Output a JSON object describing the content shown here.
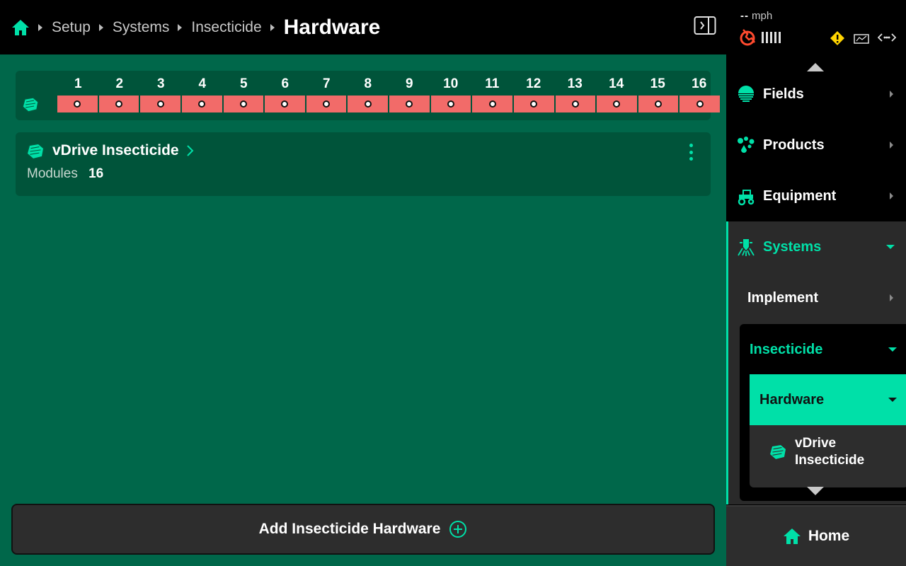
{
  "breadcrumb": {
    "items": [
      "Setup",
      "Systems",
      "Insecticide"
    ],
    "current": "Hardware"
  },
  "module_strip": {
    "rows": [
      "1",
      "2",
      "3",
      "4",
      "5",
      "6",
      "7",
      "8",
      "9",
      "10",
      "11",
      "12",
      "13",
      "14",
      "15",
      "16"
    ]
  },
  "hardware_card": {
    "title": "vDrive Insecticide",
    "modules_label": "Modules",
    "modules_value": "16"
  },
  "add_button": {
    "label": "Add Insecticide Hardware"
  },
  "status": {
    "speed_value": "--",
    "speed_unit": "mph"
  },
  "sidebar": {
    "fields": "Fields",
    "products": "Products",
    "equipment": "Equipment",
    "systems": "Systems",
    "implement": "Implement",
    "insecticide": "Insecticide",
    "hardware": "Hardware",
    "vdrive_line1": "vDrive",
    "vdrive_line2": "Insecticide",
    "home": "Home"
  },
  "colors": {
    "accent": "#00e0a8",
    "main_bg": "#00674a",
    "card_bg": "#00543a",
    "row_error": "#f26b69",
    "warning": "#ffd400",
    "gps_error": "#ff4a2e"
  }
}
